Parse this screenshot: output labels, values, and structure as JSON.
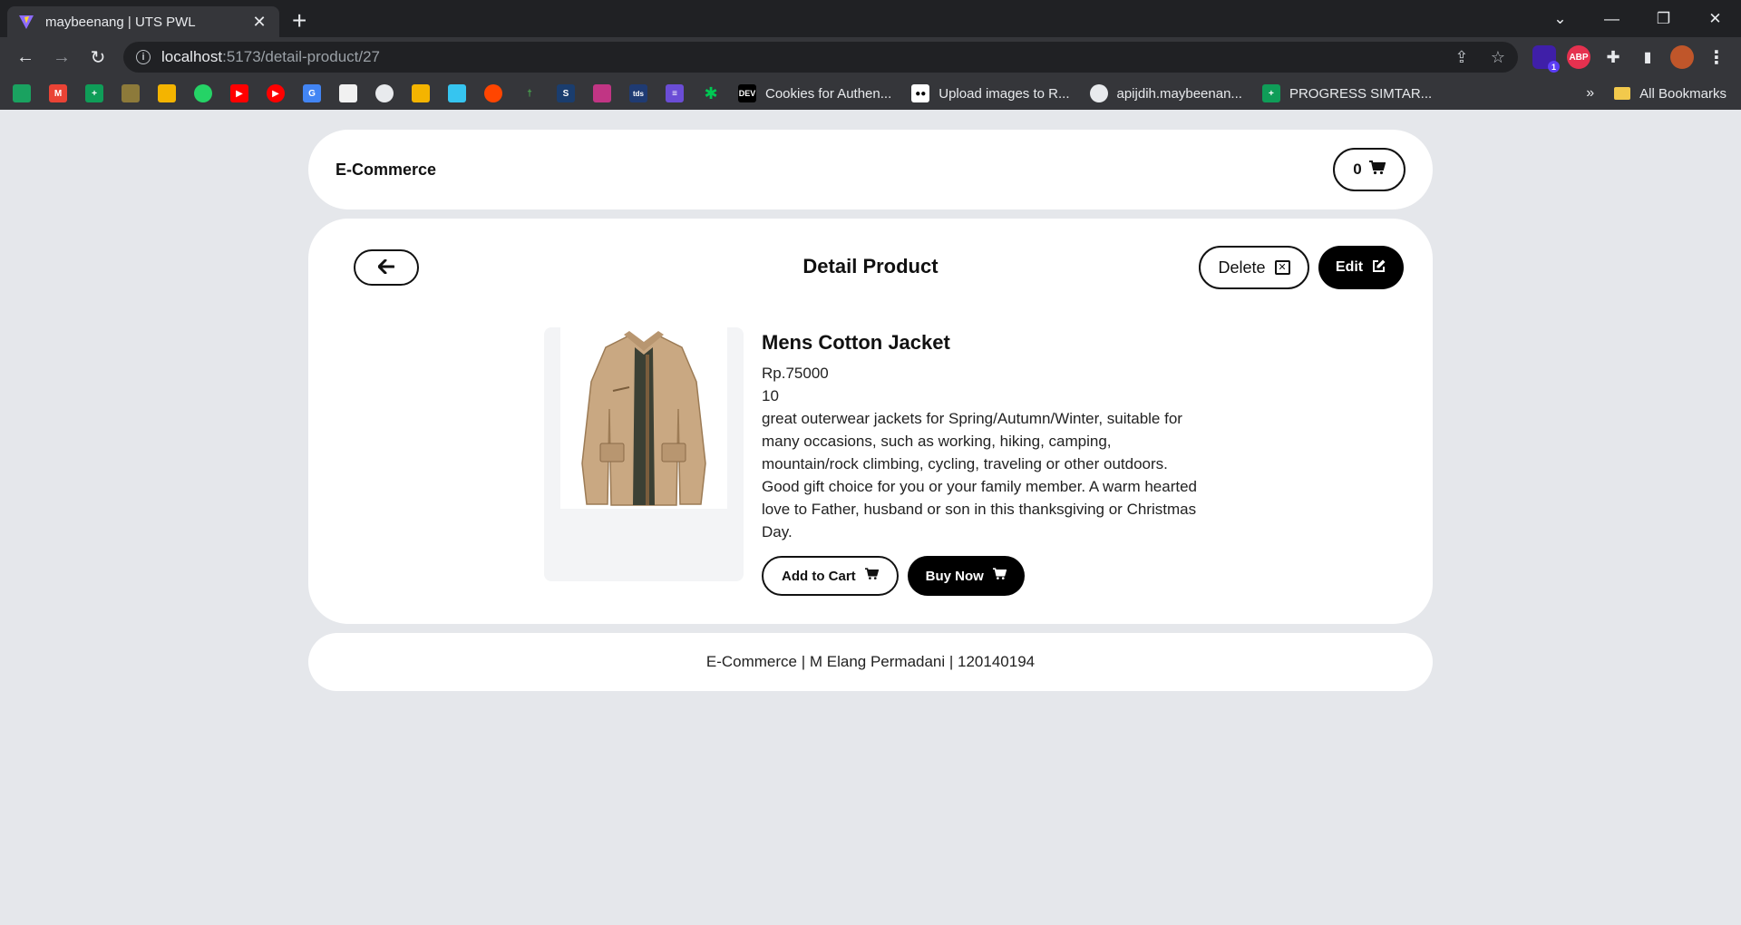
{
  "browser": {
    "tab_title": "maybeenang | UTS PWL",
    "url_host": "localhost",
    "url_path": ":5173/detail-product/27",
    "bookmarks": [
      {
        "label": "Cookies for Authen...",
        "icon": "dev-icon"
      },
      {
        "label": "Upload images to R...",
        "icon": "medium-icon"
      },
      {
        "label": "apijdih.maybeenan...",
        "icon": "globe-icon"
      },
      {
        "label": "PROGRESS SIMTAR...",
        "icon": "sheets-icon"
      }
    ],
    "all_bookmarks_label": "All Bookmarks",
    "extension_badge": "1"
  },
  "navbar": {
    "brand": "E-Commerce",
    "cart_count": "0"
  },
  "detail": {
    "title": "Detail Product",
    "delete_label": "Delete",
    "edit_label": "Edit"
  },
  "product": {
    "name": "Mens Cotton Jacket",
    "price": "Rp.75000",
    "stock": "10",
    "description": "great outerwear jackets for Spring/Autumn/Winter, suitable for many occasions, such as working, hiking, camping, mountain/rock climbing, cycling, traveling or other outdoors. Good gift choice for you or your family member. A warm hearted love to Father, husband or son in this thanksgiving or Christmas Day.",
    "add_to_cart_label": "Add to Cart",
    "buy_now_label": "Buy Now"
  },
  "footer": {
    "text": "E-Commerce | M Elang Permadani | 120140194"
  },
  "colors": {
    "page_bg": "#e5e7eb",
    "card_bg": "#ffffff",
    "accent": "#000000"
  }
}
